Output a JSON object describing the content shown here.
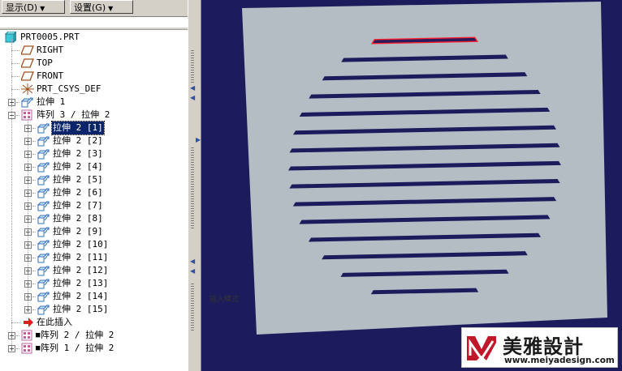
{
  "toolbar": {
    "display_label": "显示(D)",
    "settings_label": "设置(G)"
  },
  "tree": {
    "root": "PRT0005.PRT",
    "datums": [
      {
        "label": "RIGHT",
        "icon": "datum-plane-icon"
      },
      {
        "label": "TOP",
        "icon": "datum-plane-icon"
      },
      {
        "label": "FRONT",
        "icon": "datum-plane-icon"
      },
      {
        "label": "PRT_CSYS_DEF",
        "icon": "coordinate-system-icon"
      }
    ],
    "feature1": "拉伸 1",
    "pattern3": "阵列 3 / 拉伸 2",
    "pattern_members": [
      "拉伸 2 [1]",
      "拉伸 2 [2]",
      "拉伸 2 [3]",
      "拉伸 2 [4]",
      "拉伸 2 [5]",
      "拉伸 2 [6]",
      "拉伸 2 [7]",
      "拉伸 2 [8]",
      "拉伸 2 [9]",
      "拉伸 2 [10]",
      "拉伸 2 [11]",
      "拉伸 2 [12]",
      "拉伸 2 [13]",
      "拉伸 2 [14]",
      "拉伸 2 [15]"
    ],
    "selected_member": 0,
    "insert_here": "在此插入",
    "pattern2": "阵列 2 / 拉伸 2",
    "pattern1": "阵列 1 / 拉伸 2"
  },
  "viewport": {
    "status_text": "插入模式"
  },
  "watermark": {
    "name": "美雅設計",
    "url": "www.meiyadesign.com"
  },
  "colors": {
    "viewport_bg": "#1c1c5c",
    "part_face": "#b4bcc4",
    "selection": "#0a246a",
    "highlight_edge": "#ff2030",
    "watermark_accent": "#c0182a"
  }
}
